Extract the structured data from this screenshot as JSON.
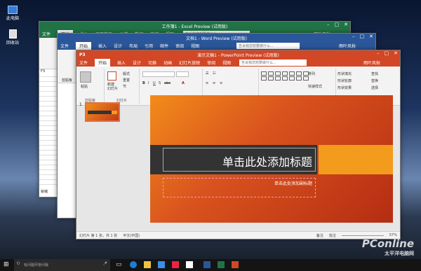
{
  "desktop": {
    "icons": [
      "此电脑",
      "回收站"
    ]
  },
  "excel": {
    "title": "工作簿1 - Excel Preview (试用版)",
    "tabs": [
      "文件",
      "开始",
      "插入",
      "页面布局",
      "公式",
      "数据",
      "审阅",
      "视图"
    ],
    "search": "告诉我您想要做什么...",
    "user": "雨叶风秋",
    "cell": "F3",
    "sheet": "就绪"
  },
  "word": {
    "title": "文档1 - Word Preview (试用版)",
    "tabs": [
      "文件",
      "开始",
      "插入",
      "设计",
      "布局",
      "引用",
      "邮件",
      "审阅",
      "视图"
    ],
    "search": "告诉我您想要做什么...",
    "user": "雨叶风秋",
    "groups": [
      "剪贴板"
    ]
  },
  "ppt": {
    "title": "演示文稿1 - PowerPoint Preview (试用版)",
    "tabs": [
      "文件",
      "开始",
      "插入",
      "设计",
      "切换",
      "动画",
      "幻灯片放映",
      "审阅",
      "视图"
    ],
    "search": "告诉我您想要做什么...",
    "user": "雨叶风秋",
    "buttons": {
      "paste": "粘贴",
      "new_slide": "新建\n幻灯片",
      "layout": "版式",
      "reset": "重置",
      "section": "节",
      "arrange": "排列",
      "quick_styles": "快速样式",
      "fill": "形状填充",
      "outline": "形状轮廓",
      "effect": "形状效果",
      "find": "查找",
      "replace": "替换",
      "select": "选择"
    },
    "groups": [
      "剪贴板",
      "幻灯片",
      "字体",
      "段落",
      "绘图",
      "编辑"
    ],
    "slide_number": "1",
    "slide_title": "单击此处添加标题",
    "slide_subtitle": "单击此处添加副标题",
    "status": {
      "left": "幻灯片 第 1 张，共 1 张",
      "lang": "中文(中国)",
      "notes": "备注",
      "comments": "批注",
      "zoom": "57%"
    }
  },
  "taskbar": {
    "search": "有问题尽管问我",
    "time": ""
  },
  "watermark": {
    "brand": "PConline",
    "sub": "太平洋电脑网"
  }
}
